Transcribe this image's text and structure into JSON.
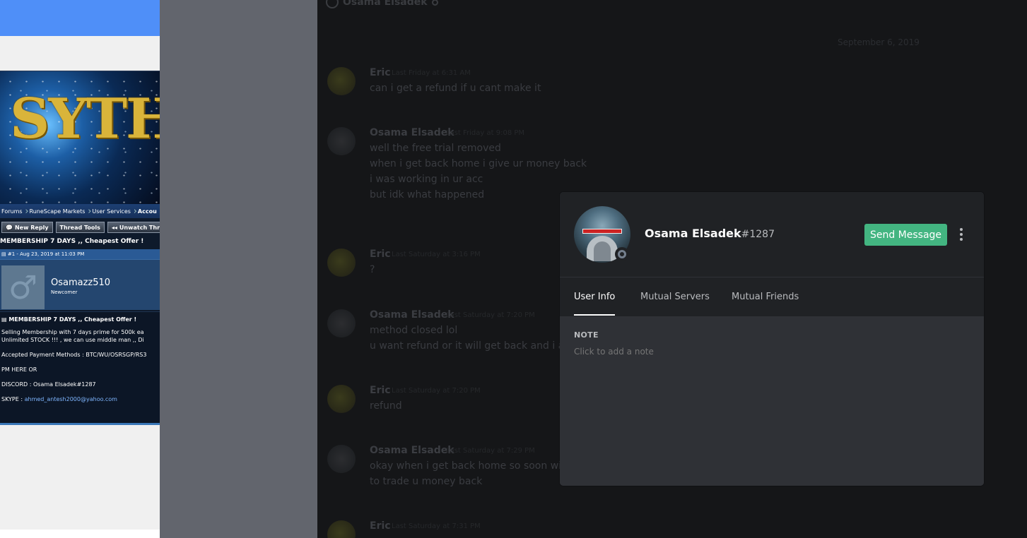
{
  "forum": {
    "banner_logo": "SYTHE",
    "breadcrumbs": [
      "Forums",
      "RuneScape Markets",
      "User Services",
      "Accou"
    ],
    "buttons": {
      "new_reply": "New Reply",
      "thread_tools": "Thread Tools",
      "unwatch": "Unwatch Threa"
    },
    "thread_title": "MEMBERSHIP 7 DAYS ,, Cheapest Offer !",
    "post_meta": "#1 - Aug 23, 2019 at 11:03 PM",
    "username": "Osamazz510",
    "user_rank": "Newcomer",
    "post_title": "MEMBERSHIP 7 DAYS ,, Cheapest Offer !",
    "post_lines": [
      "Selling Membership with 7 days prime for 500k ea",
      "Unlimited STOCK !!! , we can use middle man ,, Di",
      "Accepted Payment Methods : BTC/WU/OSRSGP/RS3",
      "PM HERE OR",
      "DISCORD : Osama Elsadek#1287"
    ],
    "skype_label": "SKYPE : ",
    "skype_email": "ahmed_antesh2000@yahoo.com"
  },
  "chat": {
    "channel_name": "Osama Elsadek",
    "date_separator": "September 6, 2019",
    "messages": [
      {
        "author": "Eric",
        "timestamp": "Last Friday at 6:31 AM",
        "lines": [
          "can i get a refund if u cant make it"
        ]
      },
      {
        "author": "Osama Elsadek",
        "timestamp": "Last Friday at 9:08 PM",
        "lines": [
          "well the free trial removed",
          "when i get back home i give ur money back",
          "i was working in ur acc",
          "but idk what happened"
        ]
      },
      {
        "author": "Eric",
        "timestamp": "Last Saturday at 3:16 PM",
        "lines": [
          "?"
        ]
      },
      {
        "author": "Osama Elsadek",
        "timestamp": "Last Saturday at 7:20 PM",
        "lines": [
          "method closed lol",
          "u want refund or it will get back and i act"
        ]
      },
      {
        "author": "Eric",
        "timestamp": "Last Saturday at 7:20 PM",
        "lines": [
          "refund"
        ]
      },
      {
        "author": "Osama Elsadek",
        "timestamp": "Last Saturday at 7:29 PM",
        "lines": [
          "okay when i get back home so soon will p",
          "to trade u money back"
        ]
      },
      {
        "author": "Eric",
        "timestamp": "Last Saturday at 7:31 PM",
        "lines": []
      }
    ]
  },
  "profile": {
    "username": "Osama Elsadek",
    "discriminator": "#1287",
    "send_message_label": "Send Message",
    "tabs": [
      "User Info",
      "Mutual Servers",
      "Mutual Friends"
    ],
    "active_tab": "User Info",
    "note_heading": "NOTE",
    "note_placeholder": "Click to add a note",
    "status": "offline"
  },
  "colors": {
    "send_button": "#43b581",
    "modal_bg": "#2f3136",
    "modal_header_bg": "#202225",
    "forum_bluebar": "#4f8ff8",
    "gutter": "#62656d"
  }
}
